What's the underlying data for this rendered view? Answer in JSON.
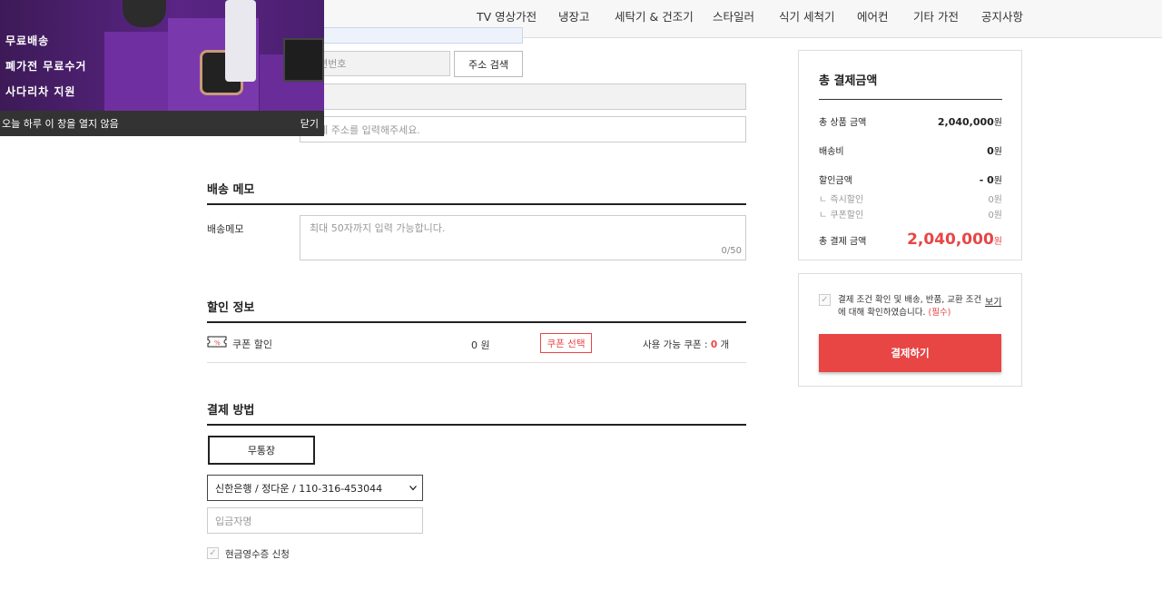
{
  "nav": {
    "items": [
      "TV 영상가전",
      "냉장고",
      "세탁기 & 건조기",
      "스타일러",
      "식기 세척기",
      "에어컨",
      "기타 가전",
      "공지사항"
    ]
  },
  "popup": {
    "line1": "무료배송",
    "line2": "폐가전 무료수거",
    "line3": "사다리차 지원",
    "hide_today": "오늘 하루 이 창을 열지 않음",
    "close": "닫기"
  },
  "address": {
    "zipcode_placeholder": "우편번호",
    "search_button": "주소 검색",
    "detail_placeholder": "상세 주소를 입력해주세요."
  },
  "memo": {
    "section_title": "배송 메모",
    "label": "배송메모",
    "placeholder": "최대 50자까지 입력 가능합니다.",
    "counter": "0/50"
  },
  "discount": {
    "section_title": "할인 정보",
    "coupon_label": "쿠폰 할인",
    "amount": "0 원",
    "select_button": "쿠폰 선택",
    "available_label": "사용 가능 쿠폰 :",
    "available_count": "0",
    "available_unit": "개"
  },
  "payment": {
    "section_title": "결제 방법",
    "method_button": "무통장",
    "bank_selected": "신한은행 / 정다운 / 110-316-453044",
    "depositor_placeholder": "입금자명",
    "receipt_label": "현금영수증 신청"
  },
  "summary": {
    "title": "총 결제금액",
    "product_label": "총 상품 금액",
    "product_value": "2,040,000",
    "shipping_label": "배송비",
    "shipping_value": "0",
    "discount_label": "할인금액",
    "discount_value": "- 0",
    "instant_label": "ㄴ 즉시할인",
    "instant_value": "0원",
    "coupon_label": "ㄴ 쿠폰할인",
    "coupon_value": "0원",
    "total_label": "총 결제 금액",
    "total_value": "2,040,000",
    "won": "원"
  },
  "agree": {
    "text_line1": "결제 조건 확인 및 배송, 반품, 교환 조건",
    "text_line2": "에 대해 확인하였습니다.",
    "required": "(필수)",
    "view": "보기",
    "pay_button": "결제하기"
  },
  "colors": {
    "accent": "#e84545",
    "popup_bg": "#5a2585"
  }
}
